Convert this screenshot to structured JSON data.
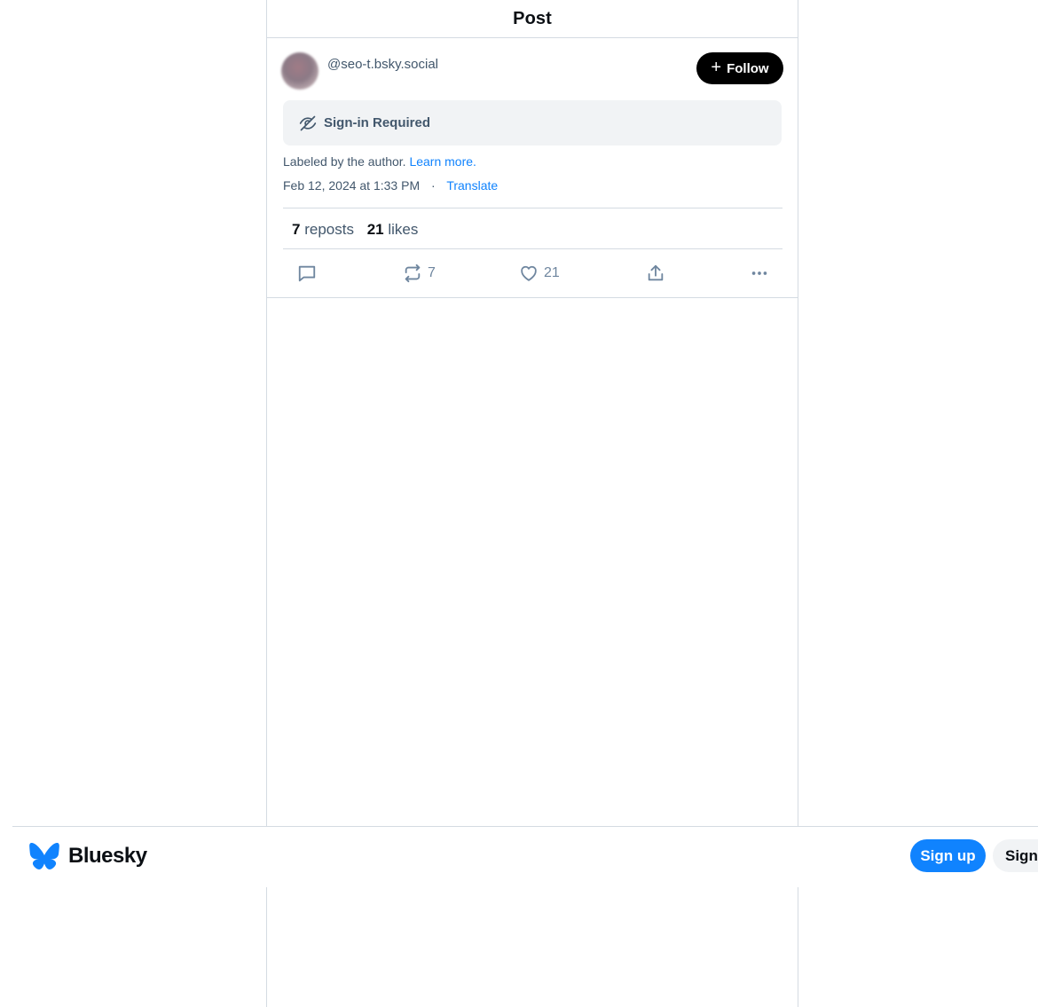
{
  "header": {
    "title": "Post"
  },
  "post": {
    "handle": "@seo-t.bsky.social",
    "follow_label": "Follow",
    "signin_required": "Sign-in Required",
    "labeled_text": "Labeled by the author.",
    "learn_more": "Learn more.",
    "date": "Feb 12, 2024 at 1:33 PM",
    "separator": "·",
    "translate": "Translate",
    "reposts_count": "7",
    "reposts_label": "reposts",
    "likes_count": "21",
    "likes_label": "likes",
    "actions": {
      "reply_icon": "reply-icon",
      "repost_icon": "repost-icon",
      "repost_count": "7",
      "like_icon": "heart-icon",
      "like_count": "21",
      "share_icon": "share-icon",
      "more_icon": "more-icon"
    }
  },
  "bottom_bar": {
    "brand": "Bluesky",
    "signup_label": "Sign up",
    "signin_label": "Sign in"
  },
  "colors": {
    "accent": "#1083fe",
    "text_muted": "#42576c",
    "border": "#d4dbe2",
    "panel": "#f1f3f5"
  }
}
